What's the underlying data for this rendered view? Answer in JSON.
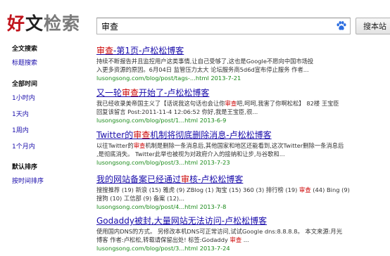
{
  "logo": {
    "c1": "好",
    "c2": "文",
    "c3": "检索"
  },
  "search": {
    "query": "审查",
    "button_label": "搜本站"
  },
  "sidebar": {
    "groups": [
      {
        "heading": "全文搜索",
        "items": [
          "标题搜索"
        ]
      },
      {
        "heading": "全部时间",
        "items": [
          "1小时内",
          "1天内",
          "1周内",
          "1个月内"
        ]
      },
      {
        "heading": "默认排序",
        "items": [
          "按时间排序"
        ]
      }
    ]
  },
  "colors": {
    "link": "#1a0dab",
    "highlight": "#cc0000",
    "url": "#1a8a1a",
    "logo_red": "#c1141c"
  },
  "results": [
    {
      "title": [
        {
          "t": "审查",
          "hl": true
        },
        {
          "t": "-第1页-卢松松博客",
          "hl": false
        }
      ],
      "snippet_lines": [
        [
          {
            "t": "持续不断报告并且监控用户这类事情,让自己受够了,这也是Google不愿向中国市场投",
            "hl": false
          }
        ],
        [
          {
            "t": "入更多资源的原因。6月04日 监管压力太大 论坛服务商5d6d宣布停止服务 作者...",
            "hl": false
          }
        ]
      ],
      "url": "lusongsong.com/blog/post/tags-...html 2013-7-21"
    },
    {
      "title": [
        {
          "t": "又一轮",
          "hl": false
        },
        {
          "t": "审查",
          "hl": true
        },
        {
          "t": "开始了-卢松松博客",
          "hl": false
        }
      ],
      "snippet_lines": [
        [
          {
            "t": "我已经收录美帝国主义了【话说我这句话也会让你",
            "hl": false
          },
          {
            "t": "审查",
            "hl": true
          },
          {
            "t": "吧,呵呵,我害了你啊松松】 82楼 王宝臣",
            "hl": false
          }
        ],
        [
          {
            "t": "回复该留言 Post:2011-11-4 12:06:52 你好,我是王宝臣,很...",
            "hl": false
          }
        ]
      ],
      "url": "lusongsong.com/blog/post/1...html 2013-6-9"
    },
    {
      "title": [
        {
          "t": "Twitter的",
          "hl": false
        },
        {
          "t": "审查",
          "hl": true
        },
        {
          "t": "机制将彻底删除消息-卢松松博客",
          "hl": false
        }
      ],
      "snippet_lines": [
        [
          {
            "t": "以往Twitter的",
            "hl": false
          },
          {
            "t": "审查",
            "hl": true
          },
          {
            "t": "机制是删除一条消息后,其他国家和地区还能看到,这次Twitter删除一条消息后",
            "hl": false
          }
        ],
        [
          {
            "t": ",是彻底消失。 Twitter此举也被视为对政府介入的接纳和让步,与谷歌和...",
            "hl": false
          }
        ]
      ],
      "url": "lusongsong.com/blog/post/3...html 2013-7-23"
    },
    {
      "title": [
        {
          "t": "我的网站备案已经通过",
          "hl": false
        },
        {
          "t": "审",
          "hl": true
        },
        {
          "t": "核-卢松松博客",
          "hl": false
        }
      ],
      "snippet_lines": [
        [
          {
            "t": "搜搜推荐 (19) 新浪 (15) 雅虎 (9) ZBlog (1) 淘宝 (15) 360 (3) 排行榜 (19) ",
            "hl": false
          },
          {
            "t": "审查",
            "hl": true
          },
          {
            "t": " (44) Bing (9)",
            "hl": false
          }
        ],
        [
          {
            "t": "搜狗 (10) 工信部 (9) 备案 (12)...",
            "hl": false
          }
        ]
      ],
      "url": "lusongsong.com/blog/post/4...html 2013-7-8"
    },
    {
      "title": [
        {
          "t": "Godaddy被封,大量网站无法访问-卢松松博客",
          "hl": false
        }
      ],
      "snippet_lines": [
        [
          {
            "t": "使用国内DNS的方式。 另修改本机DNS可正常访问,试试Google dns:8.8.8.8。 本文来源:月光",
            "hl": false
          }
        ],
        [
          {
            "t": "博客 作者:卢松松,转载请保留出处! 标签:Godaddy ",
            "hl": false
          },
          {
            "t": "审查",
            "hl": true
          },
          {
            "t": " ...",
            "hl": false
          }
        ]
      ],
      "url": "lusongsong.com/blog/post/3...html 2013-7-24"
    }
  ]
}
